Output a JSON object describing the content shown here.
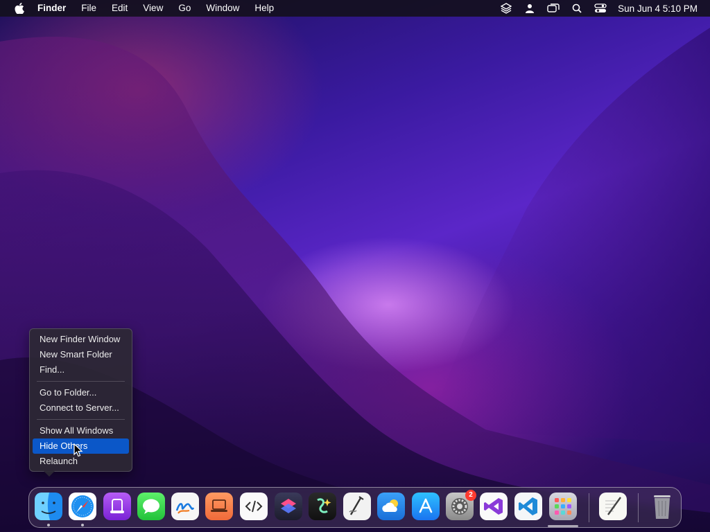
{
  "menubar": {
    "app_name": "Finder",
    "menus": [
      "File",
      "Edit",
      "View",
      "Go",
      "Window",
      "Help"
    ],
    "status_icons": [
      "layers-icon",
      "user-icon",
      "screen-mirroring-icon",
      "spotlight-search-icon",
      "control-center-icon"
    ],
    "clock": "Sun Jun 4  5:10 PM"
  },
  "context_menu": {
    "items": [
      "New Finder Window",
      "New Smart Folder",
      "Find...",
      "Go to Folder...",
      "Connect to Server...",
      "Show All Windows",
      "Hide Others",
      "Relaunch"
    ],
    "selected": "Hide Others"
  },
  "dock": {
    "apps": [
      {
        "name": "finder-icon",
        "running": true
      },
      {
        "name": "safari-icon",
        "running": true
      },
      {
        "name": "podcast-app-icon",
        "running": false
      },
      {
        "name": "messages-icon",
        "running": false
      },
      {
        "name": "freeform-icon",
        "running": false
      },
      {
        "name": "laptop-app-icon",
        "running": false
      },
      {
        "name": "code-editor-icon",
        "running": false
      },
      {
        "name": "shortcuts-icon",
        "running": false
      },
      {
        "name": "sparkle-app-icon",
        "running": false
      },
      {
        "name": "script-editor-icon",
        "running": false
      },
      {
        "name": "weather-icon",
        "running": false
      },
      {
        "name": "app-store-icon",
        "running": false
      },
      {
        "name": "system-settings-icon",
        "running": false,
        "badge": "2"
      },
      {
        "name": "visual-studio-icon",
        "running": false
      },
      {
        "name": "vscode-icon",
        "running": false
      },
      {
        "name": "launchpad-icon",
        "running": false
      },
      {
        "name": "textedit-icon",
        "running": false
      },
      {
        "name": "trash-icon",
        "running": false
      }
    ],
    "colors": {
      "selection": "#0b57c8",
      "badge": "#ff3b30"
    }
  }
}
